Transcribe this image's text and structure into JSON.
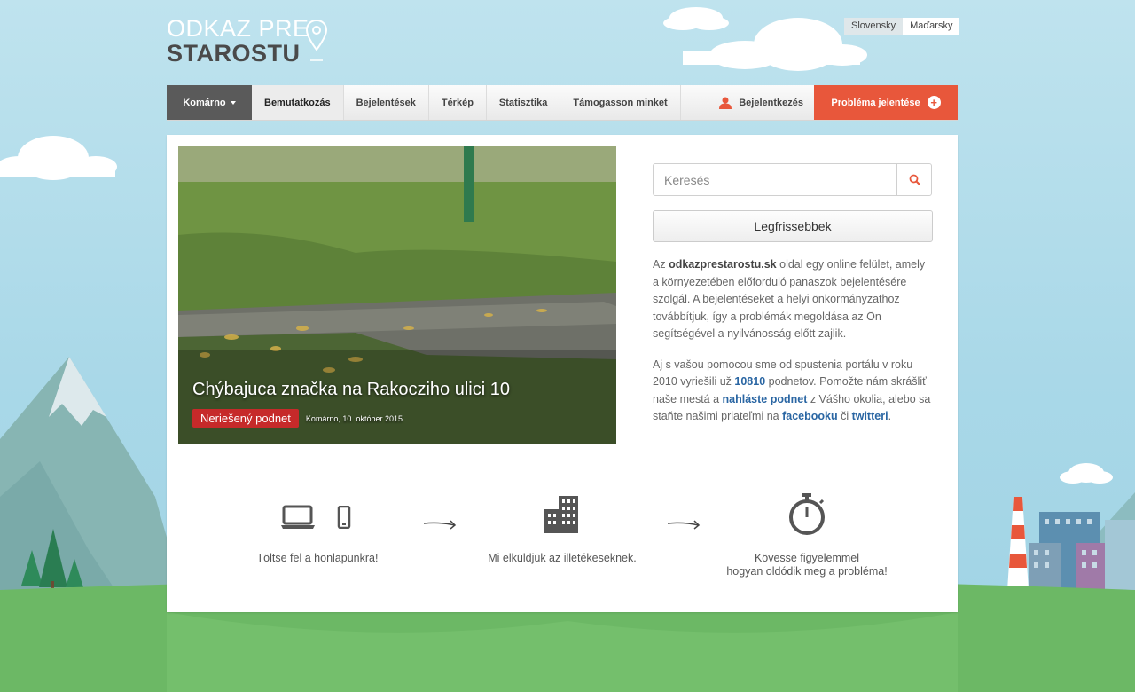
{
  "logo": {
    "line1": "ODKAZ PRE",
    "line2": "STAROSTU"
  },
  "languages": {
    "slovak": "Slovensky",
    "hungarian": "Maďarsky"
  },
  "nav": {
    "city": "Komárno",
    "items": [
      "Bemutatkozás",
      "Bejelentések",
      "Térkép",
      "Statisztika",
      "Támogasson minket"
    ],
    "login": "Bejelentkezés",
    "report": "Probléma jelentése"
  },
  "featured": {
    "title": "Chýbajuca značka na Rakocziho ulici 10",
    "status": "Neriešený podnet",
    "meta": "Komárno, 10. október 2015"
  },
  "search": {
    "placeholder": "Keresés"
  },
  "latest_button": "Legfrissebbek",
  "about": {
    "p1_pre": "Az ",
    "p1_site": "odkazprestarostu.sk",
    "p1_post": " oldal egy online felület, amely a környezetében előforduló panaszok bejelentésére szolgál. A bejelentéseket a helyi önkormányzathoz továbbítjuk, így a problémák megoldása az Ön segítségével a nyilvánosság előtt zajlik.",
    "p2_a": "Aj s vašou pomocou sme od spustenia portálu v roku 2010 vyriešili už ",
    "p2_count": "10810",
    "p2_b": " podnetov. Pomožte nám skrášliť naše mestá a ",
    "p2_link": "nahláste podnet",
    "p2_c": " z Vášho okolia, alebo sa staňte našimi priateľmi na ",
    "p2_fb": "facebooku",
    "p2_d": " či ",
    "p2_tw": "twitteri",
    "p2_e": "."
  },
  "steps": {
    "step1": "Töltse fel a honlapunkra!",
    "step2": "Mi elküldjük az illetékeseknek.",
    "step3_line1": "Kövesse figyelemmel",
    "step3_line2": "hogyan oldódik meg a probléma!"
  },
  "colors": {
    "accent": "#e8573b",
    "status": "#c62a2a",
    "link": "#2a66a3",
    "grass": "#6cb865"
  }
}
